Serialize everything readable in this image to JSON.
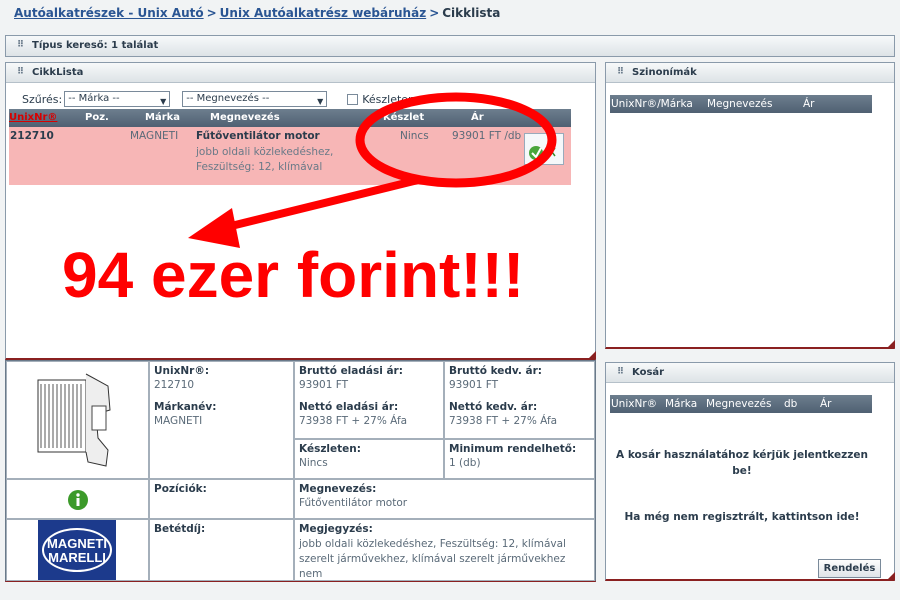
{
  "breadcrumb": {
    "link1": "Autóalkatrészek - Unix Autó",
    "link2": "Unix Autóalkatrész webáruház",
    "current": "Cikklista",
    "separator": ">"
  },
  "type_search": {
    "title": "Típus kereső: 1 találat"
  },
  "cikklista": {
    "title": "CikkLista",
    "filter_label": "Szűrés:",
    "brand_select": "-- Márka --",
    "name_select": "-- Megnevezés --",
    "stock_checkbox_label": "Készleten:",
    "columns": [
      "UnixNr®",
      "Poz.",
      "Márka",
      "Megnevezés",
      "Készlet",
      "Ár"
    ],
    "row": {
      "unixnr": "212710",
      "poz": "",
      "marka": "MAGNETI",
      "megnevezes": "Fűtőventilátor motor",
      "desc1": "jobb oldali közlekedéshez,",
      "desc2": "Feszültség: 12, klímával",
      "keszlet": "Nincs",
      "ar": "93901 FT /db"
    }
  },
  "annotation": {
    "text": "94 ezer forint!!!",
    "color": "#ff0000"
  },
  "detail": {
    "unixnr_label": "UnixNr®:",
    "unixnr_value": "212710",
    "markanev_label": "Márkanév:",
    "markanev_value": "MAGNETI",
    "poziciok_label": "Pozíciók:",
    "betetdij_label": "Betétdíj:",
    "brutto_eladasi_label": "Bruttó eladási ár:",
    "brutto_eladasi_value": "93901 FT",
    "netto_eladasi_label": "Nettó eladási ár:",
    "netto_eladasi_value": "73938 FT + 27% Áfa",
    "brutto_kedv_label": "Bruttó kedv. ár:",
    "brutto_kedv_value": "93901 FT",
    "netto_kedv_label": "Nettó kedv. ár:",
    "netto_kedv_value": "73938 FT + 27% Áfa",
    "keszleten_label": "Készleten:",
    "keszleten_value": "Nincs",
    "min_label": "Minimum rendelhető:",
    "min_value": "1 (db)",
    "megnevezes_label": "Megnevezés:",
    "megnevezes_value": "Fűtőventilátor motor",
    "megjegyzes_label": "Megjegyzés:",
    "megjegyzes_value": "jobb oldali közlekedéshez, Feszültség: 12, klímával szerelt járművekhez, klímával szerelt járművekhez nem",
    "logo_line1": "MAGNETI",
    "logo_line2": "MARELLI",
    "info_icon": "info-icon"
  },
  "szinonimak": {
    "title": "Szinonímák",
    "columns": [
      "UnixNr®/Márka",
      "Megnevezés",
      "Ár"
    ]
  },
  "kosar": {
    "title": "Kosár",
    "columns": [
      "UnixNr®",
      "Márka",
      "Megnevezés",
      "db",
      "Ár"
    ],
    "login_msg": "A kosár használatához kérjük jelentkezzen be!",
    "register_msg": "Ha még nem regisztrált, kattintson ide!",
    "order_button": "Rendelés"
  },
  "colors": {
    "header_strip": "#5d6e80",
    "row_highlight": "#f7b6b6",
    "accent_red": "#cc0000",
    "panel_bottom": "#8a2020"
  }
}
